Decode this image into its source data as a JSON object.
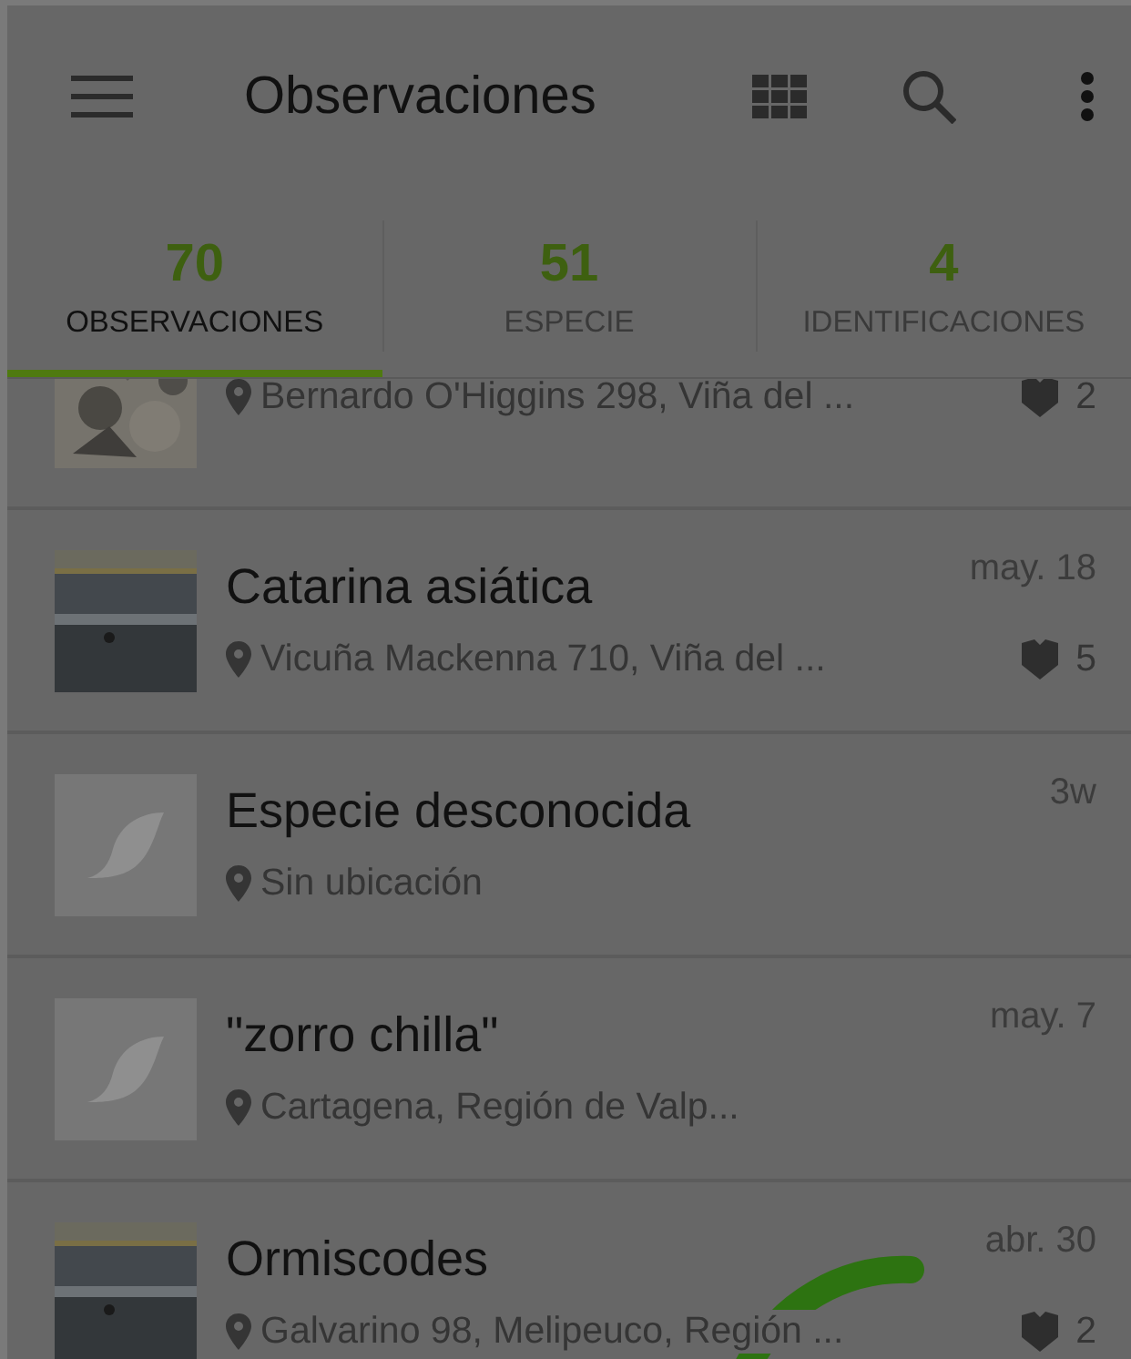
{
  "app_bar": {
    "title": "Observaciones"
  },
  "tabs": [
    {
      "count": "70",
      "label": "OBSERVACIONES",
      "selected": true
    },
    {
      "count": "51",
      "label": "ESPECIE",
      "selected": false
    },
    {
      "count": "4",
      "label": "IDENTIFICACIONES",
      "selected": false
    }
  ],
  "observations": [
    {
      "location": "Bernardo O'Higgins 298, Viña del ...",
      "identifications": "2"
    },
    {
      "title": "Catarina asiática",
      "date": "may. 18",
      "location": "Vicuña Mackenna 710, Viña del ...",
      "identifications": "5"
    },
    {
      "kind": "placeholder",
      "title": "Especie desconocida",
      "date": "3w",
      "location": "Sin ubicación"
    },
    {
      "kind": "placeholder",
      "title": "\"zorro chilla\"",
      "date": "may. 7",
      "location": "Cartagena, Región de Valp..."
    },
    {
      "title": "Ormiscodes",
      "date": "abr. 30",
      "location": "Galvarino 98, Melipeuco, Región ...",
      "identifications": "2"
    }
  ],
  "loading": true
}
